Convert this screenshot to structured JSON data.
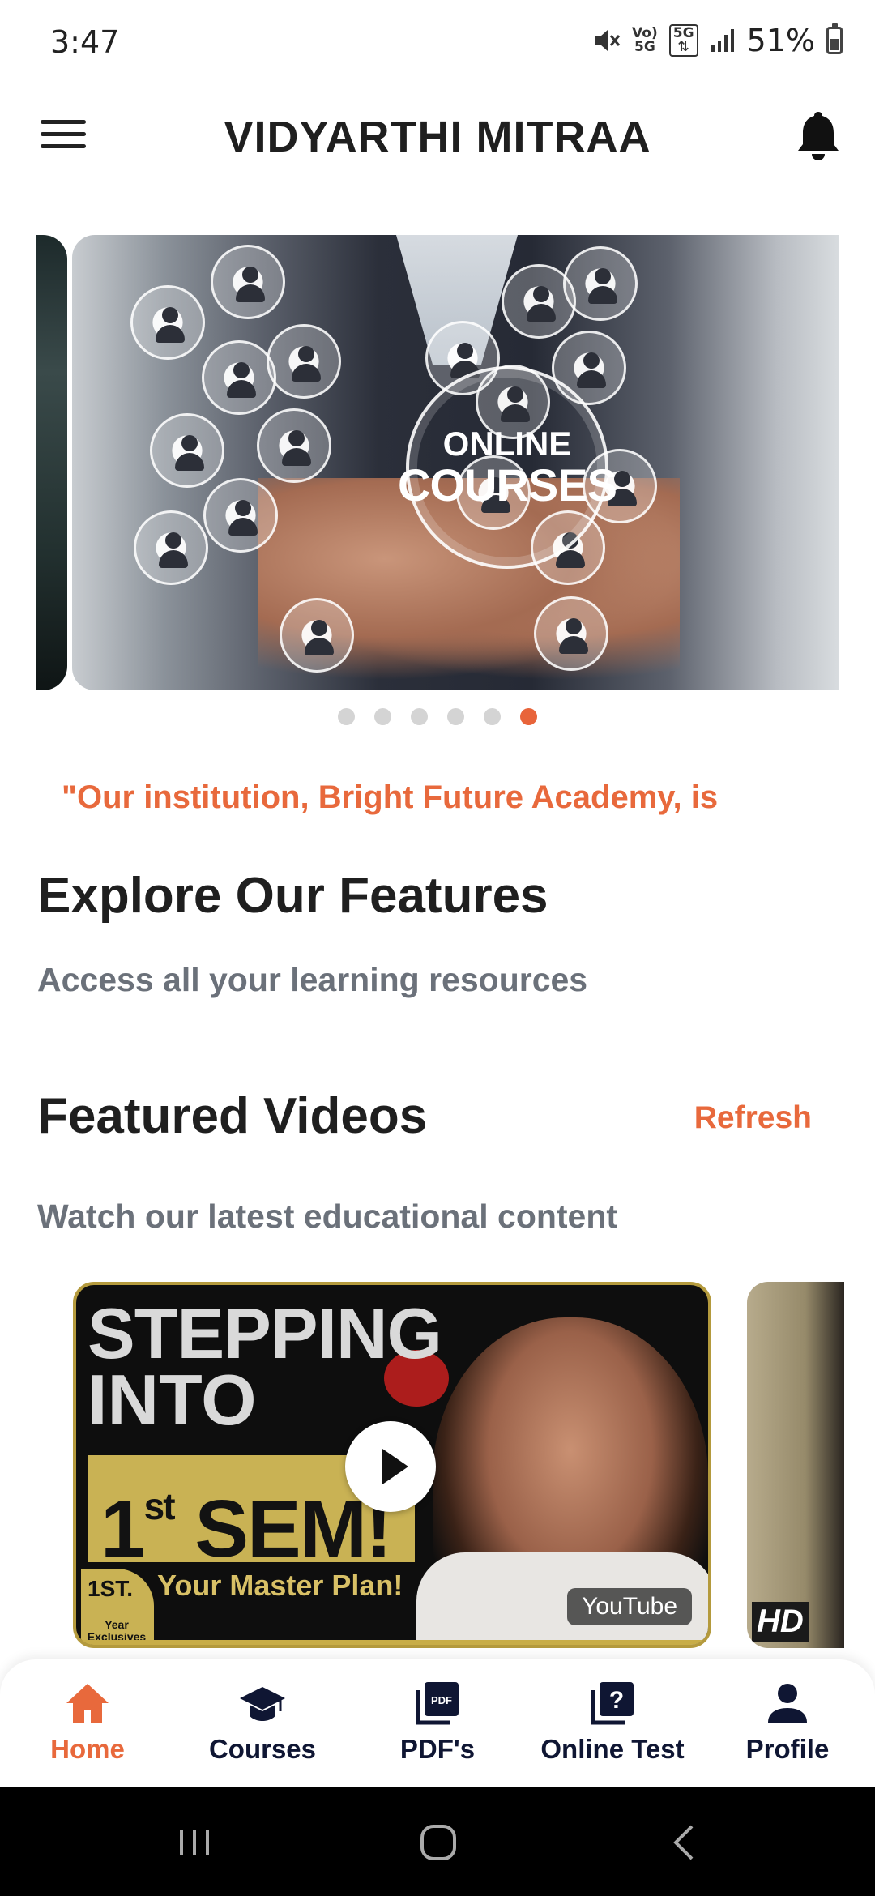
{
  "status_bar": {
    "time": "3:47",
    "signal_mini_1": "Vo)\n5G",
    "signal_mini_2": "5G",
    "battery_percent": "51%",
    "battery_level": 0.51
  },
  "app_bar": {
    "title": "VIDYARTHI MITRAA"
  },
  "carousel": {
    "slide_line1": "ONLINE",
    "slide_line2": "COURSES",
    "slide_count": 6,
    "active_index": 5
  },
  "ticker_text": "\"Our institution, Bright Future Academy, is",
  "features": {
    "title": "Explore Our Features",
    "subtitle": "Access all your learning resources"
  },
  "videos": {
    "title": "Featured Videos",
    "refresh_label": "Refresh",
    "subtitle": "Watch our latest educational content",
    "card": {
      "line1": "STEPPING",
      "line2": "INTO",
      "sem_main": "1",
      "sem_sup": "st",
      "sem_rest": " SEM!",
      "plan": "Your Master Plan!",
      "badge_main": "1ST.",
      "badge_small": "Year\nExclusives",
      "source_label": "YouTube"
    },
    "next_card_label": "HD"
  },
  "bottom_nav": {
    "items": [
      {
        "label": "Home",
        "icon": "home-icon",
        "active": true
      },
      {
        "label": "Courses",
        "icon": "graduation-cap-icon",
        "active": false
      },
      {
        "label": "PDF's",
        "icon": "pdf-icon",
        "active": false
      },
      {
        "label": "Online Test",
        "icon": "quiz-icon",
        "active": false
      },
      {
        "label": "Profile",
        "icon": "person-icon",
        "active": false
      }
    ]
  },
  "colors": {
    "accent": "#e8693c",
    "nav_text": "#0f1633",
    "title_text": "#1f1f1f",
    "subtitle_text": "#6b717a"
  }
}
